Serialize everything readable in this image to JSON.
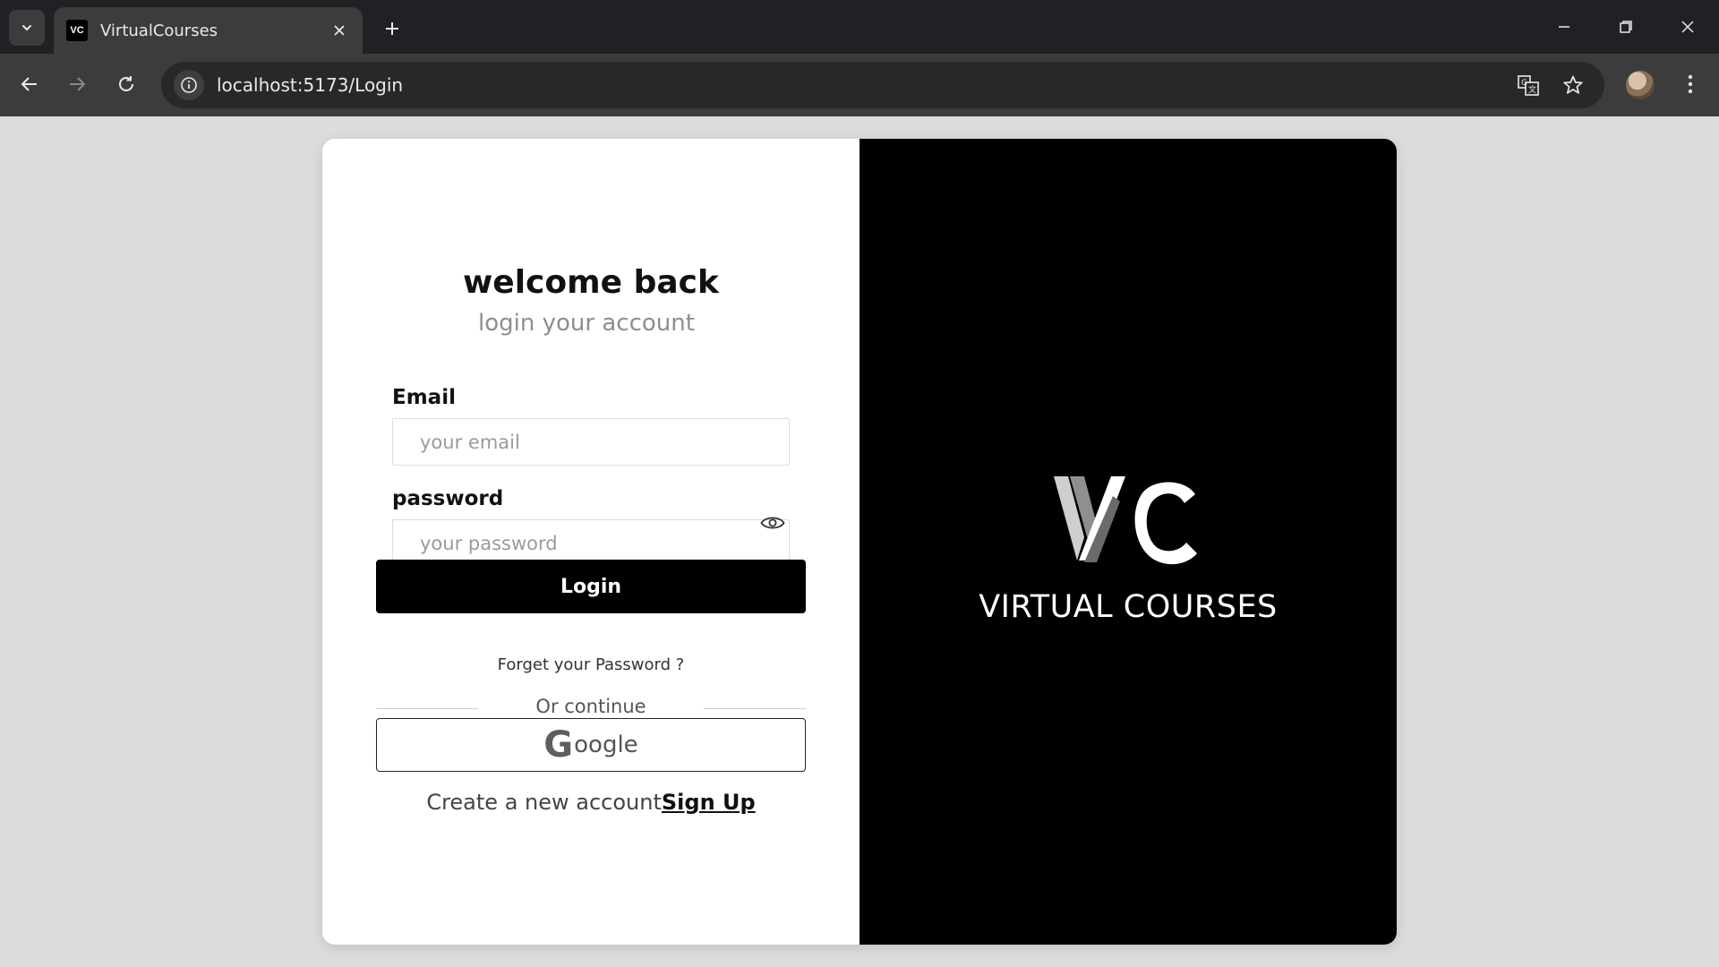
{
  "browser": {
    "tab_title": "VirtualCourses",
    "favicon_text": "VC",
    "url": "localhost:5173/Login",
    "icons": {
      "tab_list": "chevron-down-icon",
      "close_tab": "close-icon",
      "new_tab": "plus-icon",
      "minimize": "minimize-icon",
      "restore": "restore-icon",
      "close_window": "close-icon",
      "back": "arrow-left-icon",
      "forward": "arrow-right-icon",
      "reload": "reload-icon",
      "site_info": "info-icon",
      "translate": "translate-icon",
      "bookmark": "star-icon",
      "profile": "avatar",
      "menu": "kebab-menu-icon"
    }
  },
  "login": {
    "title": "welcome back",
    "subtitle": "login your account",
    "email_label": "Email",
    "email_placeholder": "your email",
    "email_value": "",
    "password_label": "password",
    "password_placeholder": "your password",
    "password_value": "",
    "login_button": "Login",
    "forgot_link": "Forget your Password ?",
    "divider_text": "Or continue",
    "google_g": "G",
    "google_rest": "oogle",
    "create_account_text": "Create a new account",
    "signup_link": "Sign Up"
  },
  "brand": {
    "name": "VIRTUAL COURSES",
    "logo_icon": "vc-logo-icon"
  },
  "colors": {
    "page_background": "#dddcdc",
    "panel_dark": "#000000",
    "panel_light": "#ffffff",
    "muted_text": "#8e8e8e"
  }
}
